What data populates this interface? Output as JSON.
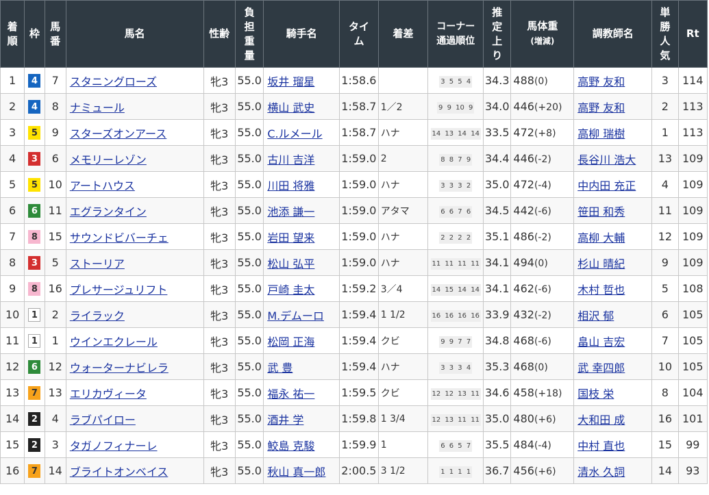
{
  "colors": {
    "header_bg": "#2f3a43",
    "link": "#1a33a0",
    "waku": {
      "1": {
        "bg": "#ffffff",
        "fg": "#333333",
        "border": "#aaaaaa"
      },
      "2": {
        "bg": "#222222",
        "fg": "#ffffff",
        "border": "#222222"
      },
      "3": {
        "bg": "#d32f2f",
        "fg": "#ffffff",
        "border": "#d32f2f"
      },
      "4": {
        "bg": "#1565c0",
        "fg": "#ffffff",
        "border": "#1565c0"
      },
      "5": {
        "bg": "#ffe300",
        "fg": "#333333",
        "border": "#ffe300"
      },
      "6": {
        "bg": "#2e8b3a",
        "fg": "#ffffff",
        "border": "#2e8b3a"
      },
      "7": {
        "bg": "#f7a21b",
        "fg": "#333333",
        "border": "#f7a21b"
      },
      "8": {
        "bg": "#f7b7cf",
        "fg": "#333333",
        "border": "#f7b7cf"
      }
    }
  },
  "headers": {
    "rank": "着順",
    "waku": "枠",
    "num": "馬番",
    "name": "馬名",
    "sexage": "性齢",
    "burden": "負担重量",
    "jockey": "騎手名",
    "time": "タイム",
    "diff": "着差",
    "corner": "コーナー通過順位",
    "last3f": "推定上り",
    "weight": "馬体重",
    "weight_sub": "(増減)",
    "trainer": "調教師名",
    "pop": "単勝人気",
    "rt": "Rt"
  },
  "rows": [
    {
      "rank": "1",
      "waku": "4",
      "num": "7",
      "name": "スタニングローズ",
      "sexage": "牝3",
      "burden": "55.0",
      "jockey": "坂井 瑠星",
      "time": "1:58.6",
      "diff": "",
      "corner": "3 5 5 4",
      "last3f": "34.3",
      "weight": "488",
      "weight_chg": "(0)",
      "trainer": "高野 友和",
      "pop": "3",
      "rt": "114"
    },
    {
      "rank": "2",
      "waku": "4",
      "num": "8",
      "name": "ナミュール",
      "sexage": "牝3",
      "burden": "55.0",
      "jockey": "横山 武史",
      "time": "1:58.7",
      "diff": "1／2",
      "corner": "9 9 10 9",
      "last3f": "34.0",
      "weight": "446",
      "weight_chg": "(+20)",
      "trainer": "高野 友和",
      "pop": "2",
      "rt": "113"
    },
    {
      "rank": "3",
      "waku": "5",
      "num": "9",
      "name": "スターズオンアース",
      "sexage": "牝3",
      "burden": "55.0",
      "jockey": "C.ルメール",
      "time": "1:58.7",
      "diff": "ハナ",
      "corner": "14 13 14 14",
      "last3f": "33.5",
      "weight": "472",
      "weight_chg": "(+8)",
      "trainer": "高柳 瑞樹",
      "pop": "1",
      "rt": "113"
    },
    {
      "rank": "4",
      "waku": "3",
      "num": "6",
      "name": "メモリーレゾン",
      "sexage": "牝3",
      "burden": "55.0",
      "jockey": "古川 吉洋",
      "time": "1:59.0",
      "diff": "2",
      "corner": "8 8 7 9",
      "last3f": "34.4",
      "weight": "446",
      "weight_chg": "(-2)",
      "trainer": "長谷川 浩大",
      "pop": "13",
      "rt": "109"
    },
    {
      "rank": "5",
      "waku": "5",
      "num": "10",
      "name": "アートハウス",
      "sexage": "牝3",
      "burden": "55.0",
      "jockey": "川田 将雅",
      "time": "1:59.0",
      "diff": "ハナ",
      "corner": "3 3 3 2",
      "last3f": "35.0",
      "weight": "472",
      "weight_chg": "(-4)",
      "trainer": "中内田 充正",
      "pop": "4",
      "rt": "109"
    },
    {
      "rank": "6",
      "waku": "6",
      "num": "11",
      "name": "エグランタイン",
      "sexage": "牝3",
      "burden": "55.0",
      "jockey": "池添 謙一",
      "time": "1:59.0",
      "diff": "アタマ",
      "corner": "6 6 7 6",
      "last3f": "34.5",
      "weight": "442",
      "weight_chg": "(-6)",
      "trainer": "笹田 和秀",
      "pop": "11",
      "rt": "109"
    },
    {
      "rank": "7",
      "waku": "8",
      "num": "15",
      "name": "サウンドビバーチェ",
      "sexage": "牝3",
      "burden": "55.0",
      "jockey": "岩田 望来",
      "time": "1:59.0",
      "diff": "ハナ",
      "corner": "2 2 2 2",
      "last3f": "35.1",
      "weight": "486",
      "weight_chg": "(-2)",
      "trainer": "高柳 大輔",
      "pop": "12",
      "rt": "109"
    },
    {
      "rank": "8",
      "waku": "3",
      "num": "5",
      "name": "ストーリア",
      "sexage": "牝3",
      "burden": "55.0",
      "jockey": "松山 弘平",
      "time": "1:59.0",
      "diff": "ハナ",
      "corner": "11 11 11 11",
      "last3f": "34.1",
      "weight": "494",
      "weight_chg": "(0)",
      "trainer": "杉山 晴紀",
      "pop": "9",
      "rt": "109"
    },
    {
      "rank": "9",
      "waku": "8",
      "num": "16",
      "name": "プレサージュリフト",
      "sexage": "牝3",
      "burden": "55.0",
      "jockey": "戸崎 圭太",
      "time": "1:59.2",
      "diff": "3／4",
      "corner": "14 15 14 14",
      "last3f": "34.1",
      "weight": "462",
      "weight_chg": "(-6)",
      "trainer": "木村 哲也",
      "pop": "5",
      "rt": "108"
    },
    {
      "rank": "10",
      "waku": "1",
      "num": "2",
      "name": "ライラック",
      "sexage": "牝3",
      "burden": "55.0",
      "jockey": "M.デムーロ",
      "time": "1:59.4",
      "diff": "1 1/2",
      "corner": "16 16 16 16",
      "last3f": "33.9",
      "weight": "432",
      "weight_chg": "(-2)",
      "trainer": "相沢 郁",
      "pop": "6",
      "rt": "105"
    },
    {
      "rank": "11",
      "waku": "1",
      "num": "1",
      "name": "ウインエクレール",
      "sexage": "牝3",
      "burden": "55.0",
      "jockey": "松岡 正海",
      "time": "1:59.4",
      "diff": "クビ",
      "corner": "9 9 7 7",
      "last3f": "34.8",
      "weight": "468",
      "weight_chg": "(-6)",
      "trainer": "畠山 吉宏",
      "pop": "7",
      "rt": "105"
    },
    {
      "rank": "12",
      "waku": "6",
      "num": "12",
      "name": "ウォーターナビレラ",
      "sexage": "牝3",
      "burden": "55.0",
      "jockey": "武 豊",
      "time": "1:59.4",
      "diff": "ハナ",
      "corner": "3 3 3 4",
      "last3f": "35.3",
      "weight": "468",
      "weight_chg": "(0)",
      "trainer": "武 幸四郎",
      "pop": "10",
      "rt": "105"
    },
    {
      "rank": "13",
      "waku": "7",
      "num": "13",
      "name": "エリカヴィータ",
      "sexage": "牝3",
      "burden": "55.0",
      "jockey": "福永 祐一",
      "time": "1:59.5",
      "diff": "クビ",
      "corner": "12 12 13 11",
      "last3f": "34.6",
      "weight": "458",
      "weight_chg": "(+18)",
      "trainer": "国枝 栄",
      "pop": "8",
      "rt": "104"
    },
    {
      "rank": "14",
      "waku": "2",
      "num": "4",
      "name": "ラブパイロー",
      "sexage": "牝3",
      "burden": "55.0",
      "jockey": "酒井 学",
      "time": "1:59.8",
      "diff": "1 3/4",
      "corner": "12 13 11 11",
      "last3f": "35.0",
      "weight": "480",
      "weight_chg": "(+6)",
      "trainer": "大和田 成",
      "pop": "16",
      "rt": "101"
    },
    {
      "rank": "15",
      "waku": "2",
      "num": "3",
      "name": "タガノフィナーレ",
      "sexage": "牝3",
      "burden": "55.0",
      "jockey": "鮫島 克駿",
      "time": "1:59.9",
      "diff": "1",
      "corner": "6 6 5 7",
      "last3f": "35.5",
      "weight": "484",
      "weight_chg": "(-4)",
      "trainer": "中村 直也",
      "pop": "15",
      "rt": "99"
    },
    {
      "rank": "16",
      "waku": "7",
      "num": "14",
      "name": "ブライトオンベイス",
      "sexage": "牝3",
      "burden": "55.0",
      "jockey": "秋山 真一郎",
      "time": "2:00.5",
      "diff": "3 1/2",
      "corner": "1 1 1 1",
      "last3f": "36.7",
      "weight": "456",
      "weight_chg": "(+6)",
      "trainer": "清水 久詞",
      "pop": "14",
      "rt": "93"
    }
  ]
}
